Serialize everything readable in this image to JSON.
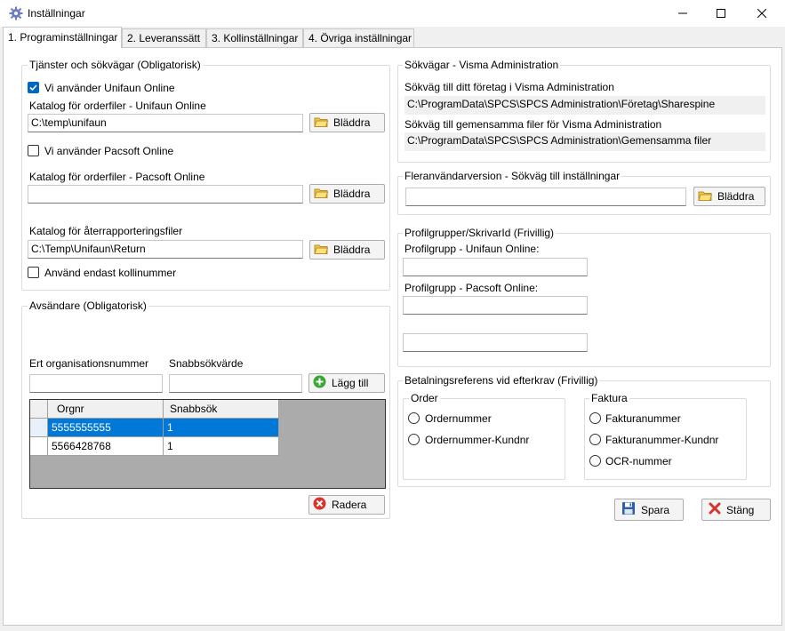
{
  "window": {
    "title": "Inställningar",
    "icon": "gear-icon",
    "controls": [
      "minimize-icon",
      "maximize-icon",
      "close-icon"
    ]
  },
  "tabs": [
    {
      "label": "1. Programinställningar",
      "active": true
    },
    {
      "label": "2. Leveranssätt",
      "active": false
    },
    {
      "label": "3. Kollinställningar",
      "active": false
    },
    {
      "label": "4. Övriga inställningar",
      "active": false
    }
  ],
  "services": {
    "title": "Tjänster och sökvägar (Obligatorisk)",
    "unifaun_checkbox_label": "Vi använder Unifaun Online",
    "unifaun_checked": true,
    "unifaun_dir_label": "Katalog för orderfiler - Unifaun Online",
    "unifaun_dir_value": "C:\\temp\\unifaun",
    "pacsoft_checkbox_label": "Vi använder Pacsoft Online",
    "pacsoft_checked": false,
    "pacsoft_dir_label": "Katalog för orderfiler - Pacsoft Online",
    "pacsoft_dir_value": "",
    "return_dir_label": "Katalog för återrapporteringsfiler",
    "return_dir_value": "C:\\Temp\\Unifaun\\Return",
    "kolli_checkbox_label": "Använd endast kollinummer",
    "kolli_checked": false,
    "browse_label": "Bläddra"
  },
  "sender": {
    "title": "Avsändare (Obligatorisk)",
    "org_label": "Ert organisationsnummer",
    "quick_label": "Snabbsökvärde",
    "org_value": "",
    "quick_value": "",
    "add_label": "Lägg till",
    "columns": [
      "Orgnr",
      "Snabbsök"
    ],
    "rows": [
      {
        "orgnr": "5555555555",
        "snabbsok": "1",
        "selected": true
      },
      {
        "orgnr": "5566428768",
        "snabbsok": "1",
        "selected": false
      }
    ],
    "delete_label": "Radera"
  },
  "visma": {
    "title": "Sökvägar - Visma Administration",
    "company_label": "Sökväg till ditt företag i Visma Administration",
    "company_value": "C:\\ProgramData\\SPCS\\SPCS Administration\\Företag\\Sharespine",
    "common_label": "Sökväg till gemensamma filer för Visma Administration",
    "common_value": "C:\\ProgramData\\SPCS\\SPCS Administration\\Gemensamma filer"
  },
  "multiuser": {
    "title": "Fleranvändarversion - Sökväg till inställningar",
    "value": "",
    "browse_label": "Bläddra"
  },
  "profiles": {
    "title": "Profilgrupper/SkrivarId (Frivillig)",
    "unifaun_label": "Profilgrupp - Unifaun Online:",
    "unifaun_value": "",
    "pacsoft_label": "Profilgrupp - Pacsoft Online:",
    "pacsoft_value": "",
    "third_value": ""
  },
  "payment": {
    "title": "Betalningsreferens vid efterkrav (Frivillig)",
    "order_title": "Order",
    "order_options": [
      "Ordernummer",
      "Ordernummer-Kundnr"
    ],
    "invoice_title": "Faktura",
    "invoice_options": [
      "Fakturanummer",
      "Fakturanummer-Kundnr",
      "OCR-nummer"
    ]
  },
  "footer": {
    "save_label": "Spara",
    "close_label": "Stäng"
  }
}
